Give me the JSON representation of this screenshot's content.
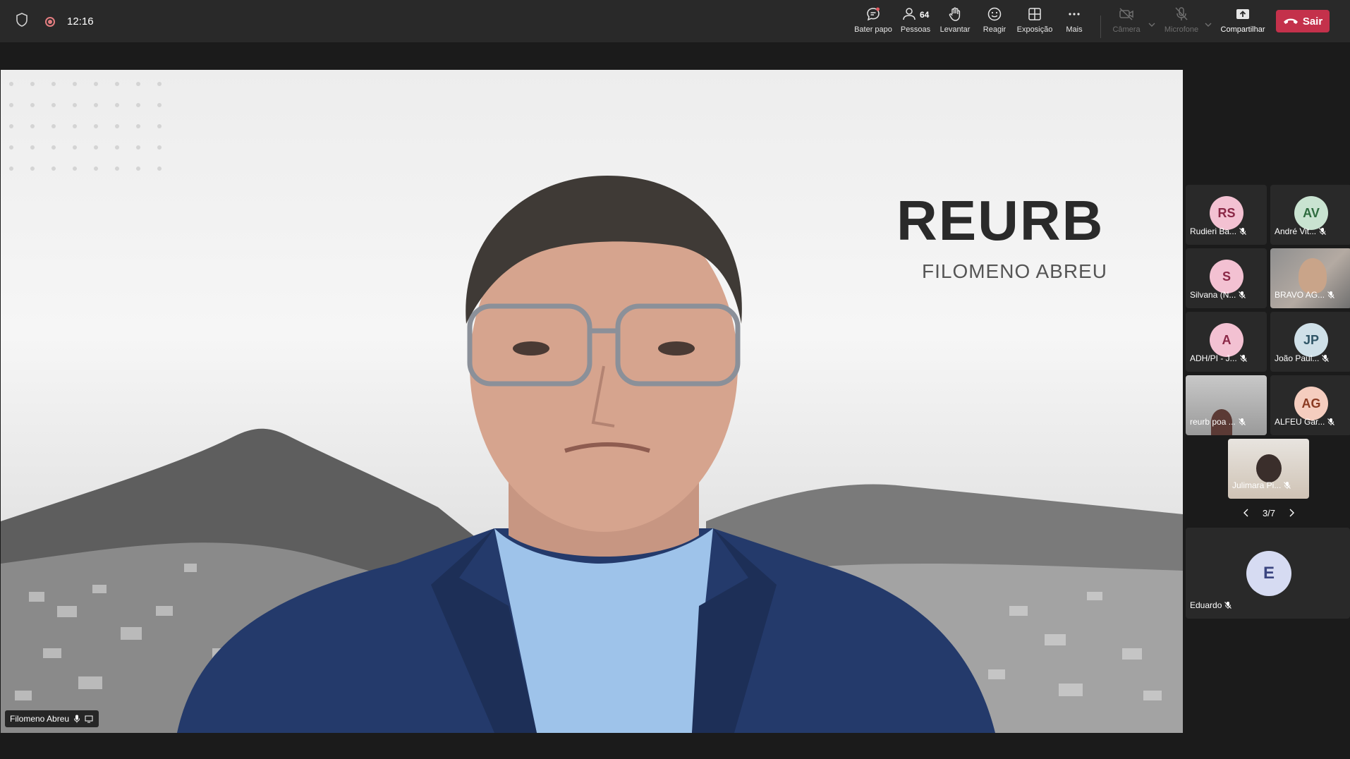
{
  "status": {
    "time": "12:16"
  },
  "toolbar": {
    "chat": {
      "label": "Bater papo",
      "icon": "chat-icon"
    },
    "people": {
      "label": "Pessoas",
      "count": "64",
      "icon": "people-icon"
    },
    "raise": {
      "label": "Levantar",
      "icon": "hand-icon"
    },
    "react": {
      "label": "Reagir",
      "icon": "smile-icon"
    },
    "view": {
      "label": "Exposição",
      "icon": "grid-icon"
    },
    "more": {
      "label": "Mais",
      "icon": "more-icon"
    },
    "camera": {
      "label": "Câmera",
      "icon": "camera-off-icon"
    },
    "mic": {
      "label": "Microfone",
      "icon": "mic-off-icon"
    },
    "share": {
      "label": "Compartilhar",
      "icon": "share-icon"
    },
    "leave": {
      "label": "Sair",
      "icon": "hangup-icon",
      "color": "#c4314b"
    }
  },
  "main_video": {
    "speaker": "Filomeno Abreu",
    "slide_title": "REURB",
    "slide_subtitle": "FILOMENO ABREU"
  },
  "gallery": {
    "tiles": [
      {
        "initials": "RS",
        "name": "Rudieri Ba...",
        "bg": "#f3c1d2",
        "fg": "#8a2746"
      },
      {
        "initials": "AV",
        "name": "André Vit...",
        "bg": "#c9e3d1",
        "fg": "#2e6b3f"
      },
      {
        "initials": "S",
        "name": "Silvana (N...",
        "bg": "#f3c1d2",
        "fg": "#8a2746"
      },
      {
        "initials": "",
        "name": "BRAVO AG...",
        "bg": "#9a8f87",
        "fg": "#fff"
      },
      {
        "initials": "A",
        "name": "ADH/PI - J...",
        "bg": "#f3c1d2",
        "fg": "#8a2746"
      },
      {
        "initials": "JP",
        "name": "João Paul...",
        "bg": "#cfe0e8",
        "fg": "#2f5566"
      },
      {
        "initials": "",
        "name": "reurb poa ...",
        "bg": "#8a8a8a",
        "fg": "#fff"
      },
      {
        "initials": "AG",
        "name": "ALFEU Gar...",
        "bg": "#f5cdbf",
        "fg": "#8a3a22"
      },
      {
        "initials": "",
        "name": "Julimara Pi...",
        "bg": "#d8d2cb",
        "fg": "#fff"
      }
    ],
    "page": "3/7",
    "featured": {
      "initials": "E",
      "name": "Eduardo",
      "bg": "#d6dbf2",
      "fg": "#3a4580"
    }
  }
}
